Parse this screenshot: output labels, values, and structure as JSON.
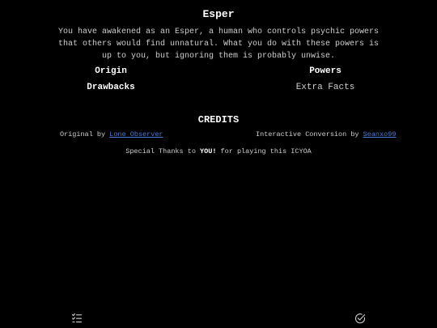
{
  "header": {
    "title": "Esper",
    "intro": "You have awakened as an Esper, a human who controls psychic powers that others would find unnatural. What you do with these powers is up to you, but ignoring them is probably unwise."
  },
  "nav": {
    "origin": "Origin",
    "powers": "Powers",
    "drawbacks": "Drawbacks",
    "extra_facts": "Extra Facts"
  },
  "credits": {
    "title": "CREDITS",
    "original_prefix": "Original by ",
    "original_author": "Lone Observer",
    "conversion_prefix": "Interactive Conversion by ",
    "conversion_author": "Seanxo99",
    "thanks_prefix": "Special Thanks to ",
    "thanks_you": "YOU!",
    "thanks_suffix": " for playing this ICYOA"
  },
  "footer": {
    "left_icon": "checklist-icon",
    "right_icon": "check-circle-icon"
  },
  "colors": {
    "background": "#000000",
    "link": "#4a7bd6",
    "text": "#d8d8d8"
  }
}
